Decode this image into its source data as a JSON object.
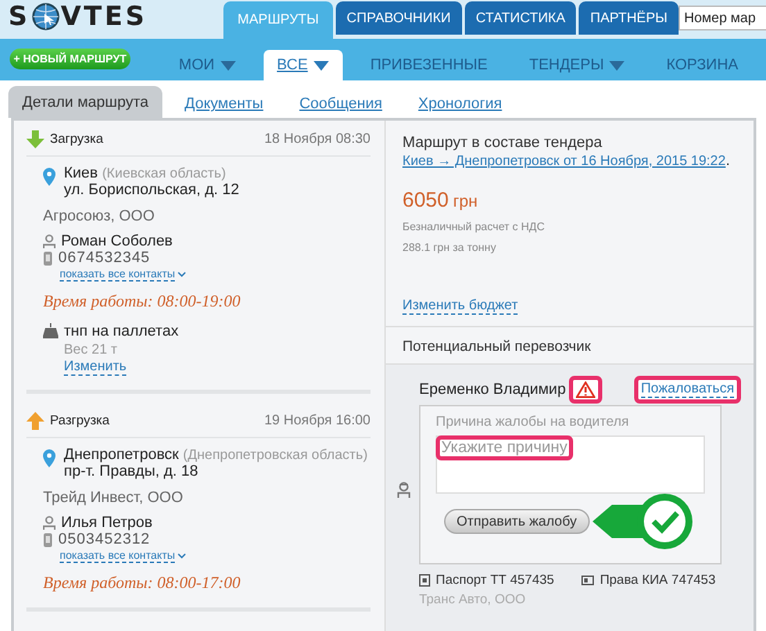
{
  "logo": {
    "left": "S",
    "right": "VTES"
  },
  "main_tabs": [
    {
      "label": "МАРШРУТЫ",
      "selected": true
    },
    {
      "label": "СПРАВОЧНИКИ",
      "selected": false
    },
    {
      "label": "СТАТИСТИКА",
      "selected": false
    },
    {
      "label": "ПАРТНЁРЫ",
      "selected": false
    }
  ],
  "search": {
    "placeholder": "Номер мар"
  },
  "new_route_button": "+ НОВЫЙ МАРШРУТ",
  "sub_tabs": [
    {
      "label": "МОИ",
      "selected": false,
      "dropdown": true
    },
    {
      "label": "ВСЕ",
      "selected": true,
      "dropdown": true
    },
    {
      "label": "ПРИВЕЗЕННЫЕ",
      "selected": false,
      "dropdown": false
    },
    {
      "label": "ТЕНДЕРЫ",
      "selected": false,
      "dropdown": true
    },
    {
      "label": "КОРЗИНА",
      "selected": false,
      "dropdown": false
    }
  ],
  "detail_tabs": [
    {
      "label": "Детали маршрута",
      "selected": true
    },
    {
      "label": "Документы",
      "selected": false
    },
    {
      "label": "Сообщения",
      "selected": false
    },
    {
      "label": "Хронология",
      "selected": false
    }
  ],
  "stops": [
    {
      "kind": "loading",
      "title": "Загрузка",
      "datetime": "18 Ноября 08:30",
      "city": "Киев",
      "region": "(Киевская область)",
      "address": "ул. Бориспольская, д. 12",
      "company": "Агросоюз, ООО",
      "contact": "Роман Соболев",
      "phone": "0674532345",
      "contacts_link": "показать все контакты",
      "hours": "Время работы: 08:00-19:00",
      "cargo": {
        "name": "тнп на паллетах",
        "weight": "Вес 21 т",
        "edit": "Изменить"
      }
    },
    {
      "kind": "unloading",
      "title": "Разгрузка",
      "datetime": "19 Ноября 16:00",
      "city": "Днепропетровск",
      "region": "(Днепропетровская область)",
      "address": "пр-т. Правды, д. 18",
      "company": "Трейд Инвест, ООО",
      "contact": "Илья Петров",
      "phone": "0503452312",
      "contacts_link": "показать все контакты",
      "hours": "Время работы: 08:00-17:00"
    }
  ],
  "route_info": {
    "text": "Маршрут в составе тендера",
    "tender_link": "Киев → Днепропетровск от 16 Ноября, 2015 19:22",
    "suffix": ".",
    "price": "6050",
    "currency": "грн",
    "payment": "Безналичный расчет с НДС",
    "per_ton": "288.1 грн за тонну",
    "edit_budget": "Изменить бюджет"
  },
  "carrier": {
    "heading": "Потенциальный перевозчик",
    "driver": "Еременко Владимир",
    "complain_link": "Пожаловаться",
    "form_label": "Причина жалобы на водителя",
    "placeholder": "Укажите причину",
    "submit": "Отправить жалобу",
    "passport": "Паспорт ТТ 457435",
    "license": "Права КИА 747453",
    "company": "Транс Авто, ООО"
  }
}
